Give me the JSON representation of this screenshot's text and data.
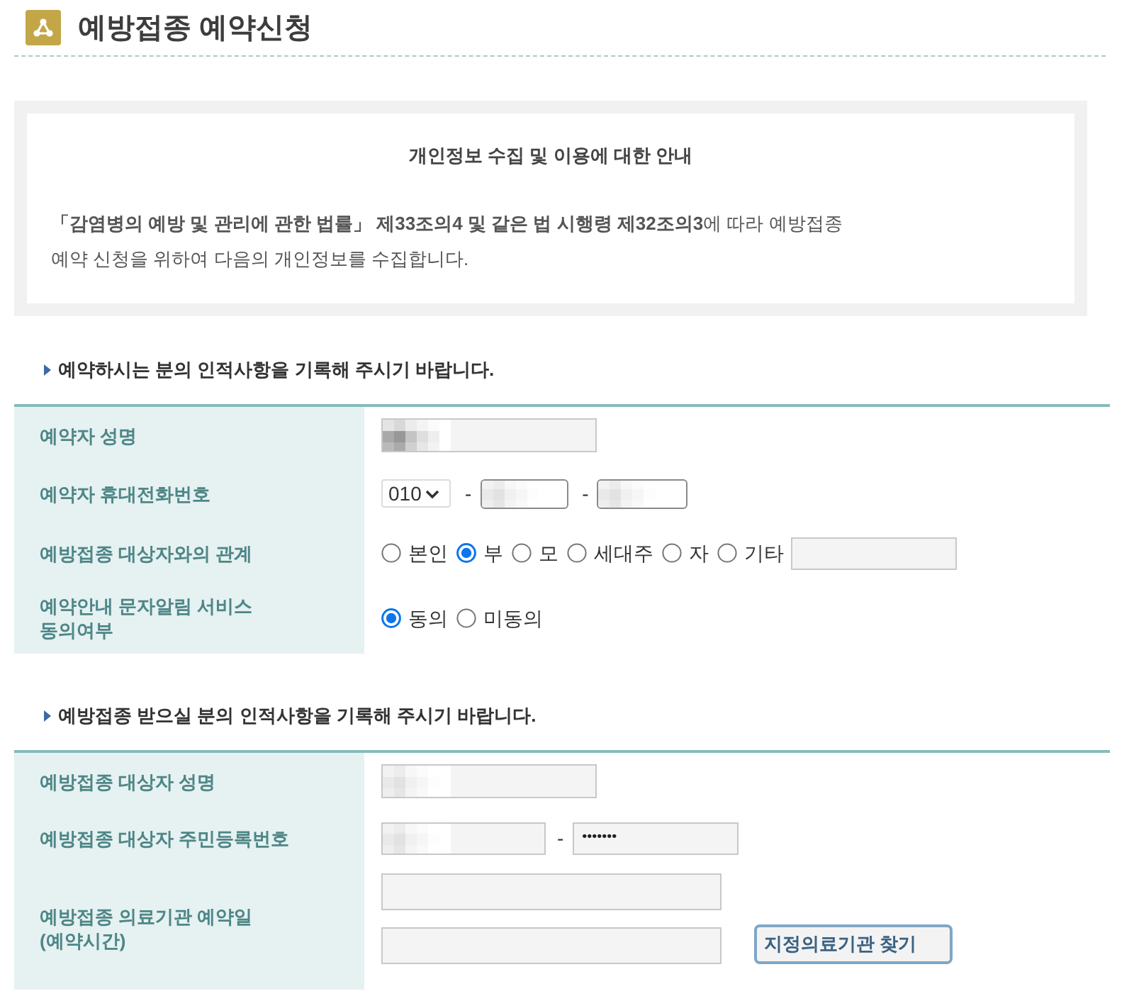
{
  "header": {
    "title": "예방접종 예약신청"
  },
  "notice": {
    "title": "개인정보 수집 및 이용에 대한 안내",
    "body": "**「감염병의 예방 및 관리에 관한 법률」 제33조의4 및 같은 법 시행령 제32조의3**에 따라 예방접종\n예약 신청을 위하여 다음의 개인정보를 수집합니다."
  },
  "sections": [
    {
      "heading": "예약하시는 분의 인적사항을 기록해 주시기 바랍니다.",
      "rows": [
        {
          "kind": "name",
          "label": "예약자 성명",
          "field": {
            "redacted": true
          }
        },
        {
          "kind": "phone",
          "label": "예약자 휴대전화번호",
          "prefix": "010",
          "parts": [
            {
              "separator": "-",
              "redacted": true
            },
            {
              "separator": "-",
              "redacted": true
            }
          ]
        },
        {
          "kind": "choice",
          "label": "예방접종 대상자와의 관계",
          "options": [
            {
              "label": "본인",
              "selected": false,
              "kind": "plain"
            },
            {
              "label": "부",
              "selected": true,
              "kind": "plain"
            },
            {
              "label": "모",
              "selected": false,
              "kind": "plain"
            },
            {
              "label": "세대주",
              "selected": false,
              "kind": "plain"
            },
            {
              "label": "자",
              "selected": false,
              "kind": "plain"
            },
            {
              "label": "기타",
              "selected": false,
              "kind": "other"
            }
          ]
        },
        {
          "kind": "choice",
          "label": "예약안내 문자알림 서비스\n동의여부",
          "options": [
            {
              "label": "동의",
              "selected": true,
              "kind": "plain"
            },
            {
              "label": "미동의",
              "selected": false,
              "kind": "plain"
            }
          ]
        }
      ]
    },
    {
      "heading": "예방접종 받으실 분의 인적사항을 기록해 주시기 바랍니다.",
      "rows": [
        {
          "kind": "name",
          "label": "예방접종 대상자 성명",
          "field": {
            "redacted": true
          }
        },
        {
          "kind": "id_number",
          "label": "예방접종 대상자 주민등록번호",
          "front": {
            "redacted": true
          },
          "separator": "-",
          "back": {
            "value": "•••••••"
          }
        },
        {
          "kind": "date",
          "label": "예방접종 의료기관 예약일\n(예약시간)",
          "button": "지정의료기관 찾기"
        }
      ]
    }
  ]
}
